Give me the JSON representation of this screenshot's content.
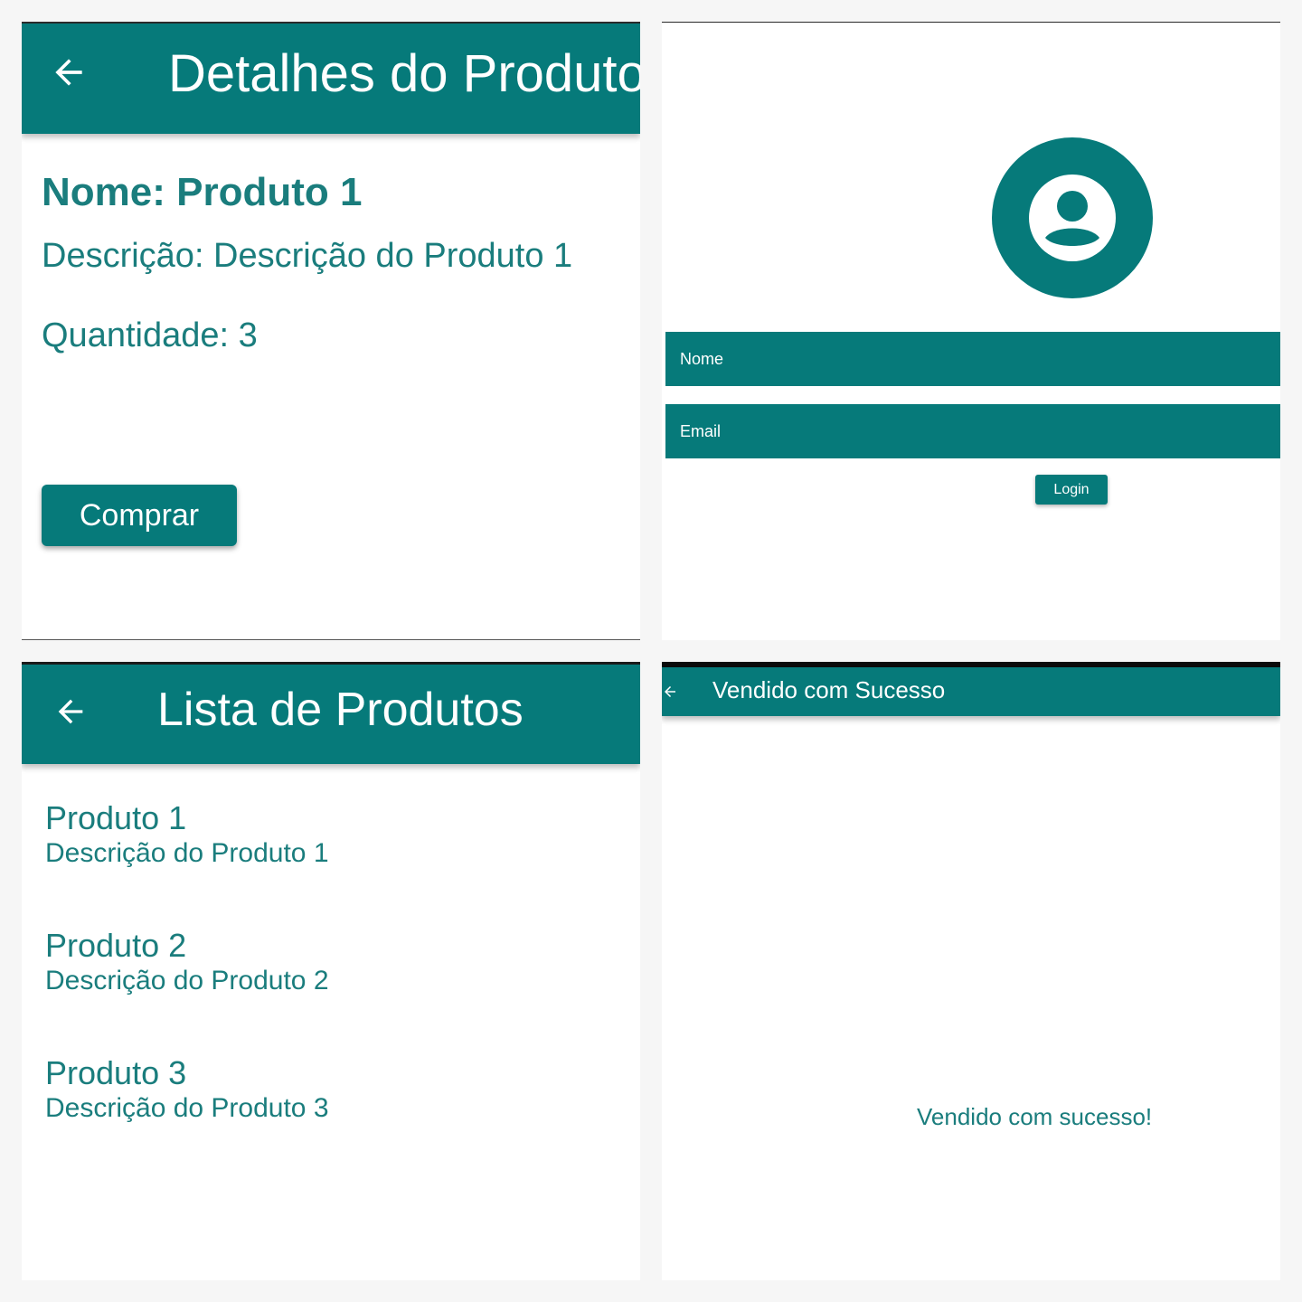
{
  "colors": {
    "primary": "#067a7a",
    "text_teal": "#1a7d7d",
    "background": "#ffffff"
  },
  "product_details": {
    "appbar": {
      "title": "Detalhes do Produto",
      "back_icon": "arrow-left-icon"
    },
    "name": "Nome: Produto 1",
    "description": "Descrição: Descrição do Produto 1",
    "quantity": "Quantidade: 3",
    "buy_label": "Comprar"
  },
  "login": {
    "avatar_icon": "account-circle-icon",
    "name_field": "Nome",
    "email_field": "Email",
    "login_label": "Login"
  },
  "product_list": {
    "appbar": {
      "title": "Lista de Produtos",
      "back_icon": "arrow-left-icon"
    },
    "items": [
      {
        "title": "Produto 1",
        "description": "Descrição do Produto 1"
      },
      {
        "title": "Produto 2",
        "description": "Descrição do Produto 2"
      },
      {
        "title": "Produto 3",
        "description": "Descrição do Produto 3"
      }
    ]
  },
  "sale_success": {
    "appbar": {
      "title": "Vendido com Sucesso",
      "back_icon": "arrow-left-icon"
    },
    "message": "Vendido com sucesso!"
  }
}
